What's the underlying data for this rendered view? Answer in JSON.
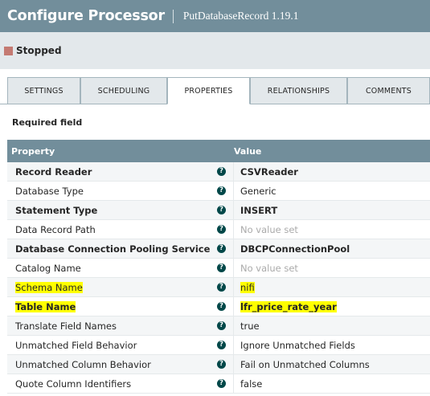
{
  "header": {
    "title": "Configure Processor",
    "subtitle": "PutDatabaseRecord 1.19.1"
  },
  "status": {
    "label": "Stopped",
    "color": "#ba554a"
  },
  "tabs": [
    {
      "label": "SETTINGS",
      "active": false
    },
    {
      "label": "SCHEDULING",
      "active": false
    },
    {
      "label": "PROPERTIES",
      "active": true
    },
    {
      "label": "RELATIONSHIPS",
      "active": false
    },
    {
      "label": "COMMENTS",
      "active": false
    }
  ],
  "required_label": "Required field",
  "table": {
    "headers": {
      "property": "Property",
      "value": "Value"
    },
    "rows": [
      {
        "name": "Record Reader",
        "value": "CSVReader",
        "required": true,
        "value_bold": true,
        "unset": false,
        "highlight": false
      },
      {
        "name": "Database Type",
        "value": "Generic",
        "required": false,
        "value_bold": false,
        "unset": false,
        "highlight": false
      },
      {
        "name": "Statement Type",
        "value": "INSERT",
        "required": true,
        "value_bold": true,
        "unset": false,
        "highlight": false
      },
      {
        "name": "Data Record Path",
        "value": "No value set",
        "required": false,
        "value_bold": false,
        "unset": true,
        "highlight": false
      },
      {
        "name": "Database Connection Pooling Service",
        "value": "DBCPConnectionPool",
        "required": true,
        "value_bold": true,
        "unset": false,
        "highlight": false
      },
      {
        "name": "Catalog Name",
        "value": "No value set",
        "required": false,
        "value_bold": false,
        "unset": true,
        "highlight": false
      },
      {
        "name": "Schema Name",
        "value": "nifi",
        "required": false,
        "value_bold": false,
        "unset": false,
        "highlight": true
      },
      {
        "name": "Table Name",
        "value": "lfr_price_rate_year",
        "required": true,
        "value_bold": true,
        "unset": false,
        "highlight": true
      },
      {
        "name": "Translate Field Names",
        "value": "true",
        "required": false,
        "value_bold": false,
        "unset": false,
        "highlight": false
      },
      {
        "name": "Unmatched Field Behavior",
        "value": "Ignore Unmatched Fields",
        "required": false,
        "value_bold": false,
        "unset": false,
        "highlight": false
      },
      {
        "name": "Unmatched Column Behavior",
        "value": "Fail on Unmatched Columns",
        "required": false,
        "value_bold": false,
        "unset": false,
        "highlight": false
      },
      {
        "name": "Quote Column Identifiers",
        "value": "false",
        "required": false,
        "value_bold": false,
        "unset": false,
        "highlight": false
      }
    ]
  },
  "help_icon": "question-circle-icon",
  "highlight_color": "#ffff00"
}
